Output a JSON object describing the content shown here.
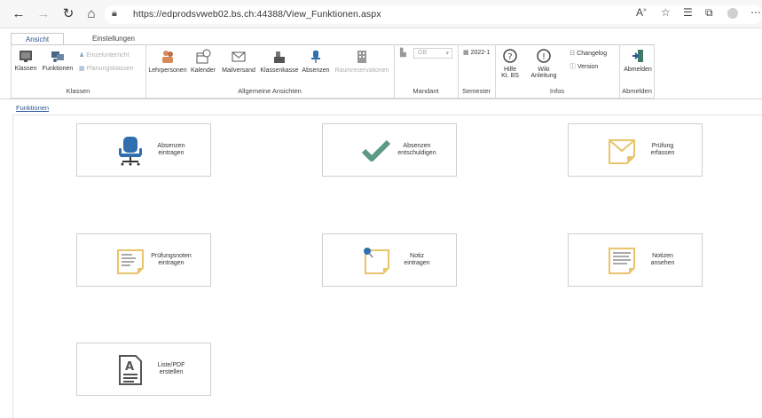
{
  "browser": {
    "url": "https://edprodsvweb02.bs.ch:44388/View_Funktionen.aspx",
    "icons": [
      "back-icon",
      "forward-icon",
      "reload-icon",
      "home-icon",
      "lock-icon",
      "read-aloud-icon",
      "favorite-add-icon",
      "favorites-icon",
      "collections-icon",
      "profile-icon",
      "more-icon"
    ]
  },
  "ribbon": {
    "tabs": [
      {
        "label": "Ansicht",
        "active": true
      },
      {
        "label": "Einstellungen",
        "active": false
      }
    ],
    "groups": {
      "klassen": {
        "label": "Klassen",
        "buttons": [
          "Klassen",
          "Funktionen"
        ],
        "small": [
          "Einzelunterricht",
          "Planungsklassen"
        ]
      },
      "allgemein": {
        "label": "Allgemeine Ansichten",
        "buttons": [
          "Lehrpersonen",
          "Kalender",
          "Mailversand",
          "Klassenkasse",
          "Absenzen",
          "Raumreservationen"
        ]
      },
      "mandant": {
        "label": "Mandant",
        "select_value": "GB"
      },
      "semester": {
        "label": "Semester",
        "value": "2022-1"
      },
      "infos": {
        "label": "Infos",
        "buttons": [
          "Hilfe Kt. BS",
          "Wiki Anleitung"
        ],
        "help_line1": "Hilfe",
        "help_line2": "Kt. BS",
        "wiki_line1": "Wiki",
        "wiki_line2": "Anleitung",
        "small": [
          "Changelog",
          "Version"
        ]
      },
      "abmelden": {
        "label": "Abmelden",
        "button": "Abmelden"
      }
    }
  },
  "breadcrumb": "Funktionen",
  "tiles": [
    {
      "line1": "Absenzen",
      "line2": "eintragen",
      "icon": "office-chair-icon"
    },
    {
      "line1": "Absenzen",
      "line2": "entschuldigen",
      "icon": "checkmark-icon"
    },
    {
      "line1": "Prüfung",
      "line2": "erfassen",
      "icon": "envelope-note-icon"
    },
    {
      "line1": "Prüfungsnoten",
      "line2": "eintragen",
      "icon": "grade-sheet-icon"
    },
    {
      "line1": "Notiz",
      "line2": "eintragen",
      "icon": "pinned-note-icon"
    },
    {
      "line1": "Notizen",
      "line2": "ansehen",
      "icon": "notes-list-icon"
    },
    {
      "line1": "Liste/PDF",
      "line2": "erstellen",
      "icon": "document-a-icon"
    }
  ],
  "colors": {
    "accent": "#2b579a",
    "chair": "#2f6fad",
    "check": "#5c9a83",
    "note": "#e8c46a"
  }
}
